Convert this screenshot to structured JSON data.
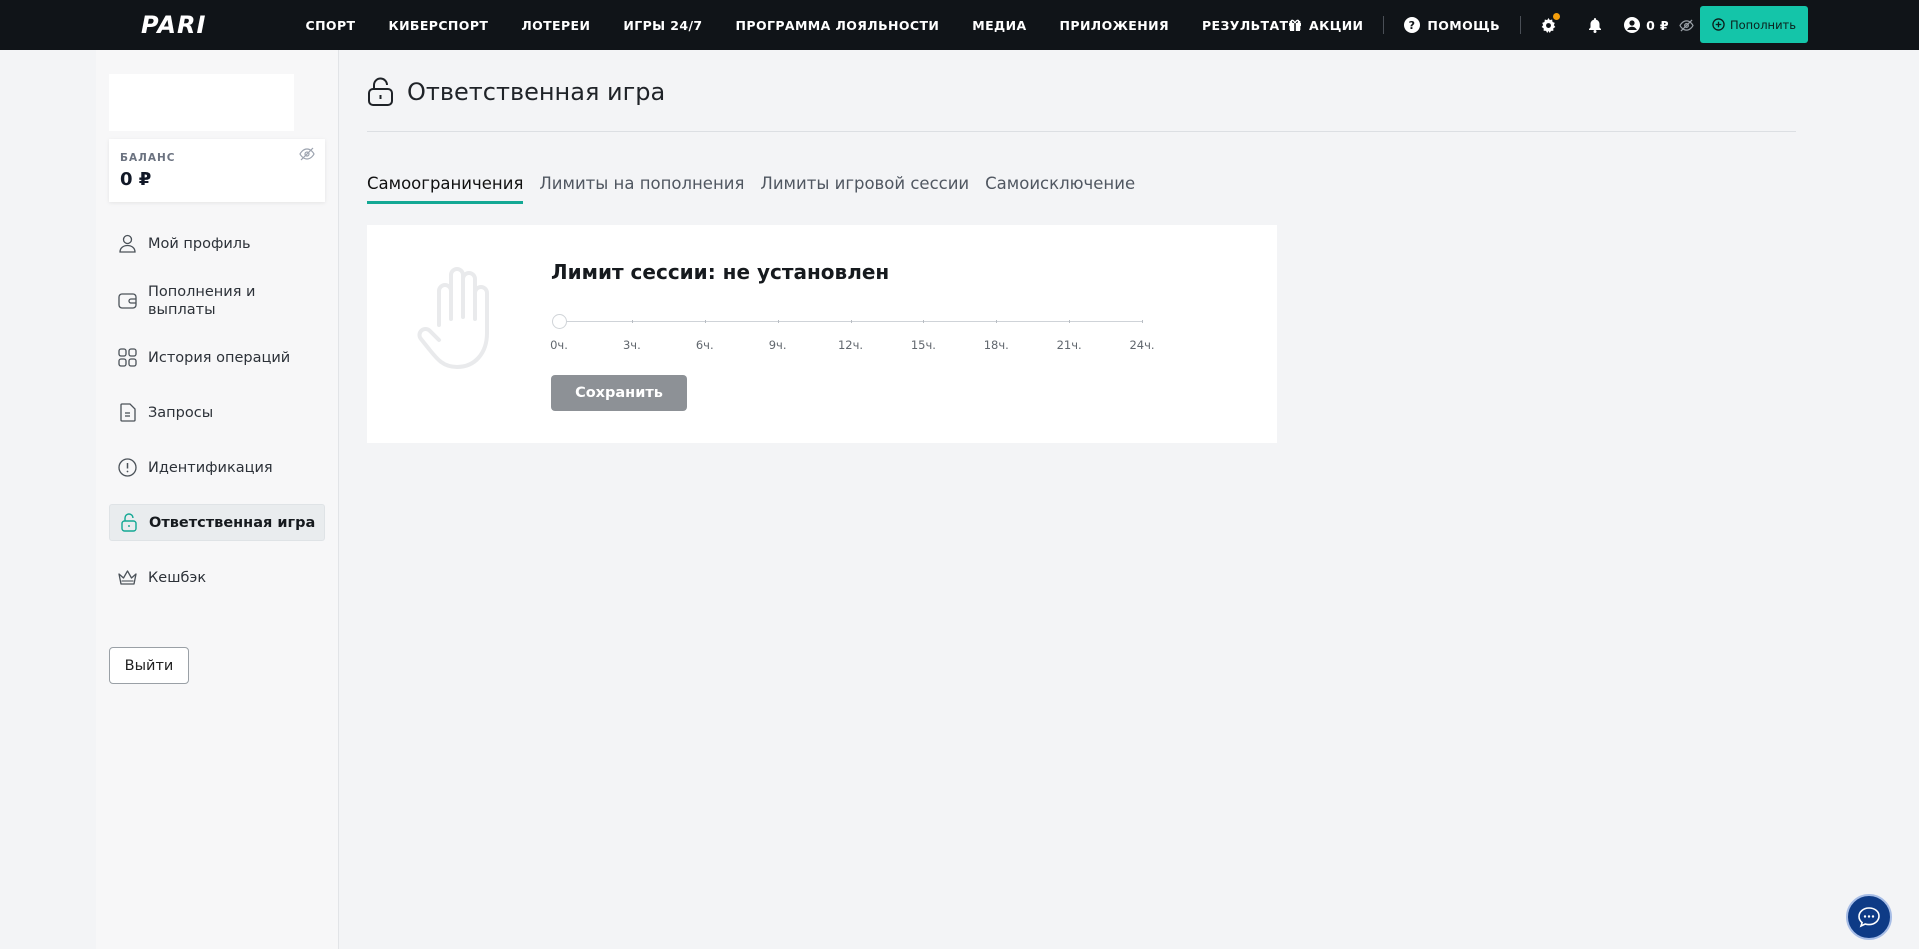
{
  "brand": {
    "logo_text": "PARI",
    "accent": "#14c5a9",
    "topbar_bg": "#101418"
  },
  "nav": {
    "items": [
      {
        "label": "СПОРТ"
      },
      {
        "label": "КИБЕРСПОРТ"
      },
      {
        "label": "ЛОТЕРЕИ"
      },
      {
        "label": "ИГРЫ 24/7"
      },
      {
        "label": "ПРОГРАММА ЛОЯЛЬНОСТИ"
      },
      {
        "label": "МЕДИА"
      },
      {
        "label": "ПРИЛОЖЕНИЯ"
      },
      {
        "label": "РЕЗУЛЬТАТЫ"
      }
    ],
    "promos_label": "АКЦИИ",
    "help_label": "ПОМОЩЬ",
    "balance_label": "0 ₽",
    "deposit_label": "Пополнить"
  },
  "sidebar": {
    "balance_title": "БАЛАНС",
    "balance_value": "0 ₽",
    "items": [
      {
        "label": "Мой профиль",
        "icon": "user-icon"
      },
      {
        "label": "Пополнения и выплаты",
        "icon": "wallet-icon"
      },
      {
        "label": "История операций",
        "icon": "grid-icon"
      },
      {
        "label": "Запросы",
        "icon": "document-icon"
      },
      {
        "label": "Идентификация",
        "icon": "alert-circle-icon"
      },
      {
        "label": "Ответственная игра",
        "icon": "lock-icon",
        "active": true
      },
      {
        "label": "Кешбэк",
        "icon": "crown-icon"
      }
    ],
    "logout_label": "Выйти"
  },
  "main": {
    "title": "Ответственная игра",
    "tabs": [
      {
        "label": "Самоограничения",
        "active": true
      },
      {
        "label": "Лимиты на пополнения"
      },
      {
        "label": "Лимиты игровой сессии"
      },
      {
        "label": "Самоисключение"
      }
    ],
    "card": {
      "title": "Лимит сессии: не установлен",
      "slider_value_hours": 0,
      "ticks": [
        "0ч.",
        "3ч.",
        "6ч.",
        "9ч.",
        "12ч.",
        "15ч.",
        "18ч.",
        "21ч.",
        "24ч."
      ],
      "save_label": "Сохранить"
    }
  }
}
